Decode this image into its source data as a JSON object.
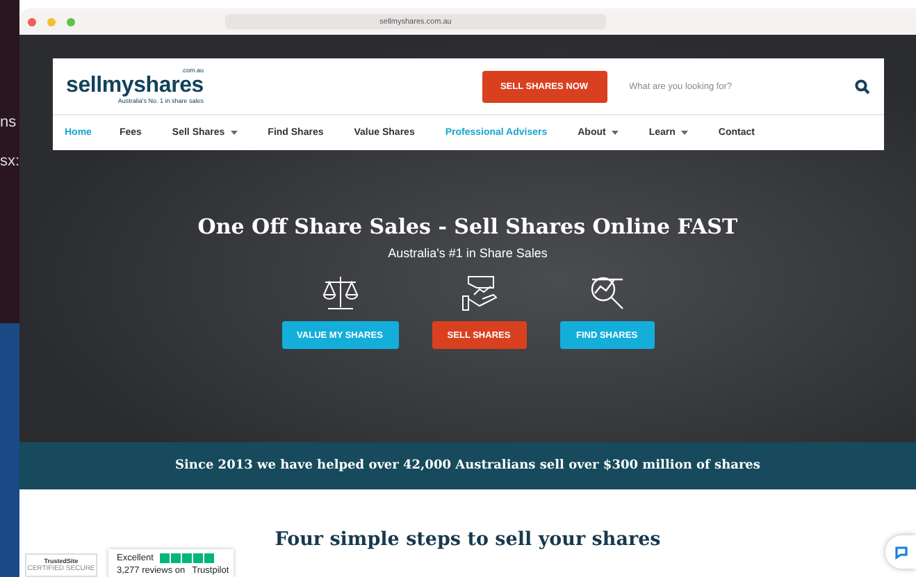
{
  "desktop_texts": [
    "ns",
    "sx:"
  ],
  "browser": {
    "url": "sellmyshares.com.au"
  },
  "logo": {
    "name": "sellmyshares",
    "domain": ".com.au",
    "tagline": "Australia's No. 1 in share sales"
  },
  "header": {
    "cta": "SELL SHARES NOW",
    "search": {
      "placeholder": "What are you looking for?"
    }
  },
  "nav": [
    {
      "label": "Home",
      "highlighted": true,
      "dropdown": false
    },
    {
      "label": "Fees",
      "highlighted": false,
      "dropdown": false
    },
    {
      "label": "Sell Shares",
      "highlighted": false,
      "dropdown": true
    },
    {
      "label": "Find Shares",
      "highlighted": false,
      "dropdown": false
    },
    {
      "label": "Value Shares",
      "highlighted": false,
      "dropdown": false
    },
    {
      "label": "Professional Advisers",
      "highlighted": true,
      "dropdown": false
    },
    {
      "label": "About",
      "highlighted": false,
      "dropdown": true
    },
    {
      "label": "Learn",
      "highlighted": false,
      "dropdown": true
    },
    {
      "label": "Contact",
      "highlighted": false,
      "dropdown": false
    }
  ],
  "hero": {
    "title": "One Off Share Sales - Sell Shares Online FAST",
    "subtitle": "Australia's #1 in Share Sales",
    "actions": [
      {
        "label": "VALUE MY SHARES",
        "kind": "value"
      },
      {
        "label": "SELL SHARES",
        "kind": "sell"
      },
      {
        "label": "FIND SHARES",
        "kind": "find"
      }
    ]
  },
  "banner": "Since 2013 we have helped over 42,000 Australians sell over $300 million of shares",
  "section_heading": "Four simple steps to sell your shares",
  "trusted_site": {
    "name": "TrustedSite",
    "caption": "CERTIFIED SECURE"
  },
  "trustpilot": {
    "rating": "Excellent",
    "stars": 5,
    "reviews": "3,277 reviews on",
    "brand": "Trustpilot"
  }
}
